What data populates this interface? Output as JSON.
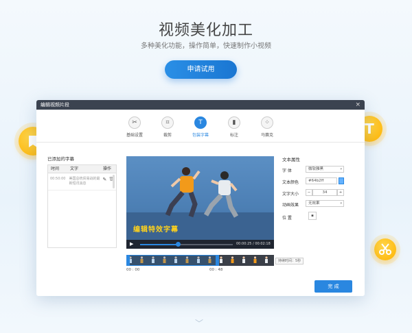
{
  "hero": {
    "title": "视频美化加工",
    "subtitle": "多种美化功能，操作简单，快速制作小视频",
    "apply_button": "申请试用"
  },
  "dialog": {
    "title": "编辑视频片段",
    "close_icon": "×",
    "tools": [
      {
        "label": "基础设置",
        "icon": "✂",
        "icon_name": "scissors-icon",
        "active": false
      },
      {
        "label": "裁剪",
        "icon": "⌗",
        "icon_name": "crop-icon",
        "active": false
      },
      {
        "label": "包装字幕",
        "icon": "T",
        "icon_name": "text-icon",
        "active": true
      },
      {
        "label": "标注",
        "icon": "▮",
        "icon_name": "bookmark-icon",
        "active": false
      },
      {
        "label": "马赛克",
        "icon": "⁘",
        "icon_name": "mosaic-icon",
        "active": false
      }
    ],
    "left_panel": {
      "title": "已添加的字幕",
      "columns": [
        "时间",
        "文字",
        "操作"
      ],
      "rows": [
        {
          "time": "00:50:00",
          "text": "美国总统贸易战的最新短讯消息",
          "edit_icon": "✎",
          "delete_icon": "🗑"
        }
      ]
    },
    "video": {
      "caption": "编辑特效字幕",
      "time_display": "00:00:25 / 00:02:18",
      "play_icon": "▶",
      "progress": 0.41
    },
    "timeline": {
      "start_time": "00 : 00",
      "end_time": "00 : 48",
      "duration_label": "持续时间：5秒",
      "selection_fraction": 0.63
    },
    "props": {
      "title": "文本属性",
      "font_label": "字 体",
      "font_value": "微软雅黑",
      "color_label": "文本颜色",
      "color_value": "#64b2ff",
      "size_label": "文字大小",
      "size_value": "34",
      "minus": "−",
      "plus": "+",
      "anim_label": "动画效果",
      "anim_value": "无效果",
      "pos_label": "位 置",
      "pos_icon": "▪"
    },
    "done_button": "完 成"
  },
  "decor": {
    "bookmark_icon": "bookmark-icon",
    "crop_icon": "crop-icon",
    "text_icon_glyph": "T",
    "mosaic_icon": "mosaic-icon",
    "scissors_icon": "scissors-icon",
    "chevron": "﹀"
  },
  "colors": {
    "accent": "#2a87e0",
    "caption": "#ffd21c",
    "badge": "#ffb300"
  }
}
